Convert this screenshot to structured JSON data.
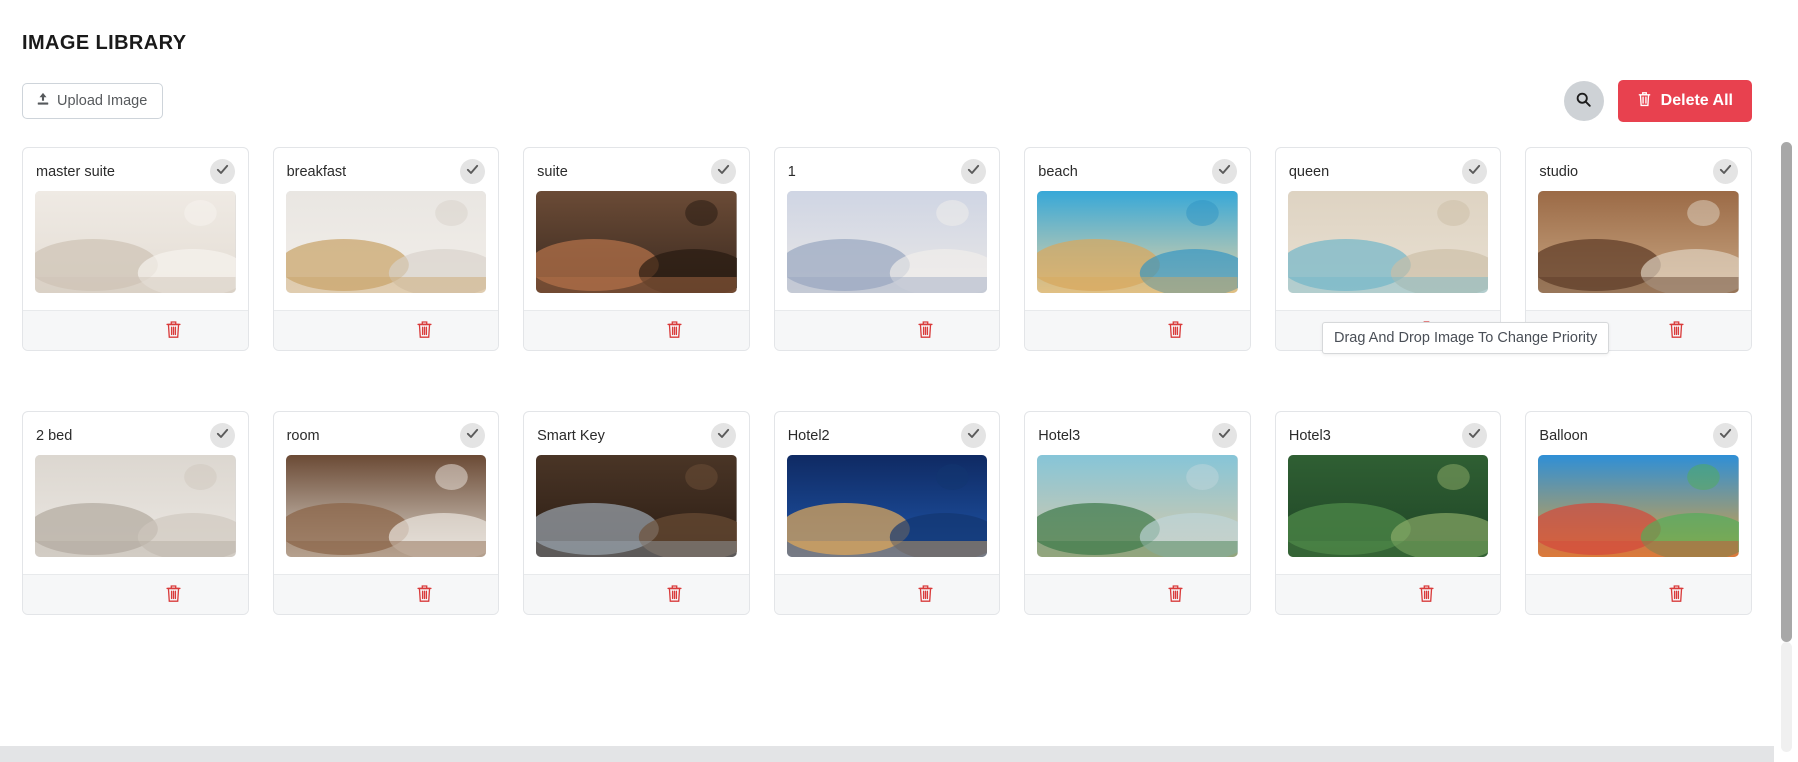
{
  "page_title": "IMAGE LIBRARY",
  "toolbar": {
    "upload_label": "Upload Image",
    "upload_icon": "upload-icon",
    "search_icon": "search-icon",
    "delete_all_label": "Delete All",
    "delete_all_icon": "trash-icon",
    "delete_all_color": "#e8414f"
  },
  "tooltip": {
    "text": "Drag And Drop Image To Change Priority"
  },
  "card_icons": {
    "check_icon": "check-icon",
    "trash_icon": "trash-icon"
  },
  "cards": [
    {
      "title": "master suite",
      "selected": true,
      "image": "bedroom-white"
    },
    {
      "title": "breakfast",
      "selected": true,
      "image": "breakfast-plate"
    },
    {
      "title": "suite",
      "selected": true,
      "image": "dark-suite"
    },
    {
      "title": "1",
      "selected": true,
      "image": "bright-bedroom"
    },
    {
      "title": "beach",
      "selected": true,
      "image": "beach-balls"
    },
    {
      "title": "queen",
      "selected": true,
      "image": "queen-seaview"
    },
    {
      "title": "studio",
      "selected": true,
      "image": "studio-room"
    },
    {
      "title": "2 bed",
      "selected": true,
      "image": "two-bed-room"
    },
    {
      "title": "room",
      "selected": true,
      "image": "hotel-room"
    },
    {
      "title": "Smart Key",
      "selected": true,
      "image": "smart-key-phone"
    },
    {
      "title": "Hotel2",
      "selected": true,
      "image": "hotel-pool-night"
    },
    {
      "title": "Hotel3",
      "selected": true,
      "image": "palm-resort"
    },
    {
      "title": "Hotel3",
      "selected": true,
      "image": "jungle-resort"
    },
    {
      "title": "Balloon",
      "selected": true,
      "image": "hot-air-balloons"
    }
  ]
}
